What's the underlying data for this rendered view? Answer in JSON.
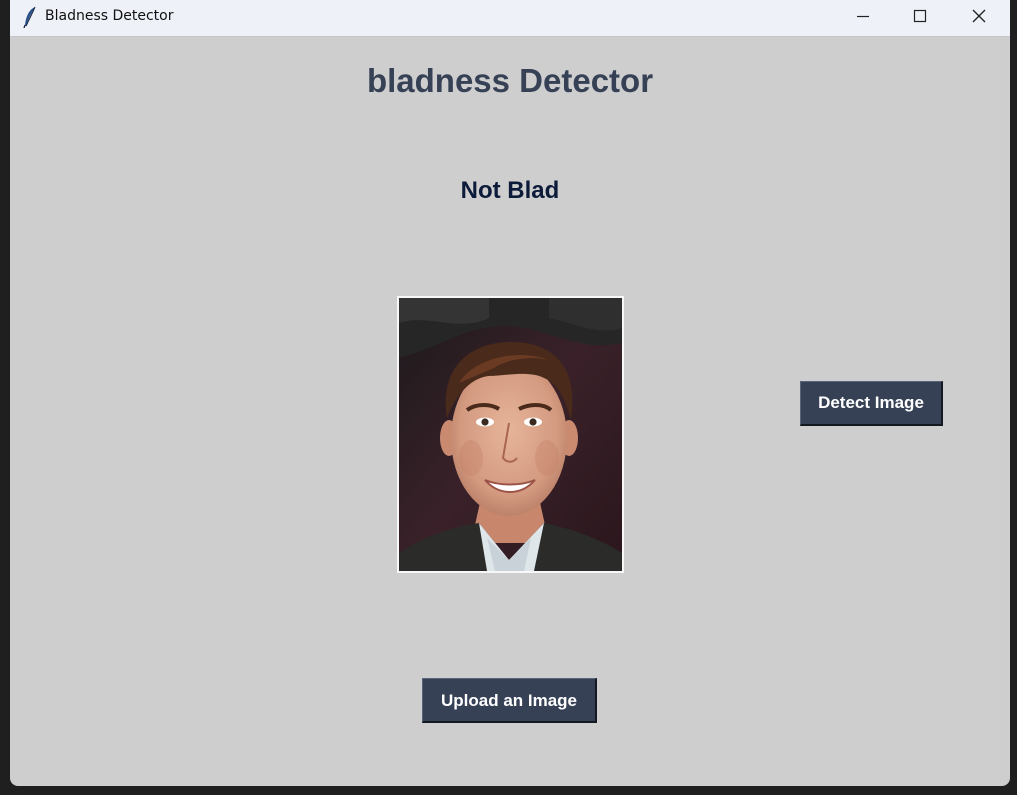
{
  "window": {
    "title": "Bladness Detector",
    "controls": [
      "minimize-icon",
      "maximize-icon",
      "close-icon"
    ]
  },
  "app": {
    "heading": "bladness Detector",
    "result": "Not Blad",
    "detect_button": "Detect Image",
    "upload_button": "Upload an Image"
  },
  "colors": {
    "background": "#cecece",
    "heading": "#364156",
    "button": "#364156",
    "button_text": "#ffffff",
    "result_text": "#0d1b3a"
  }
}
